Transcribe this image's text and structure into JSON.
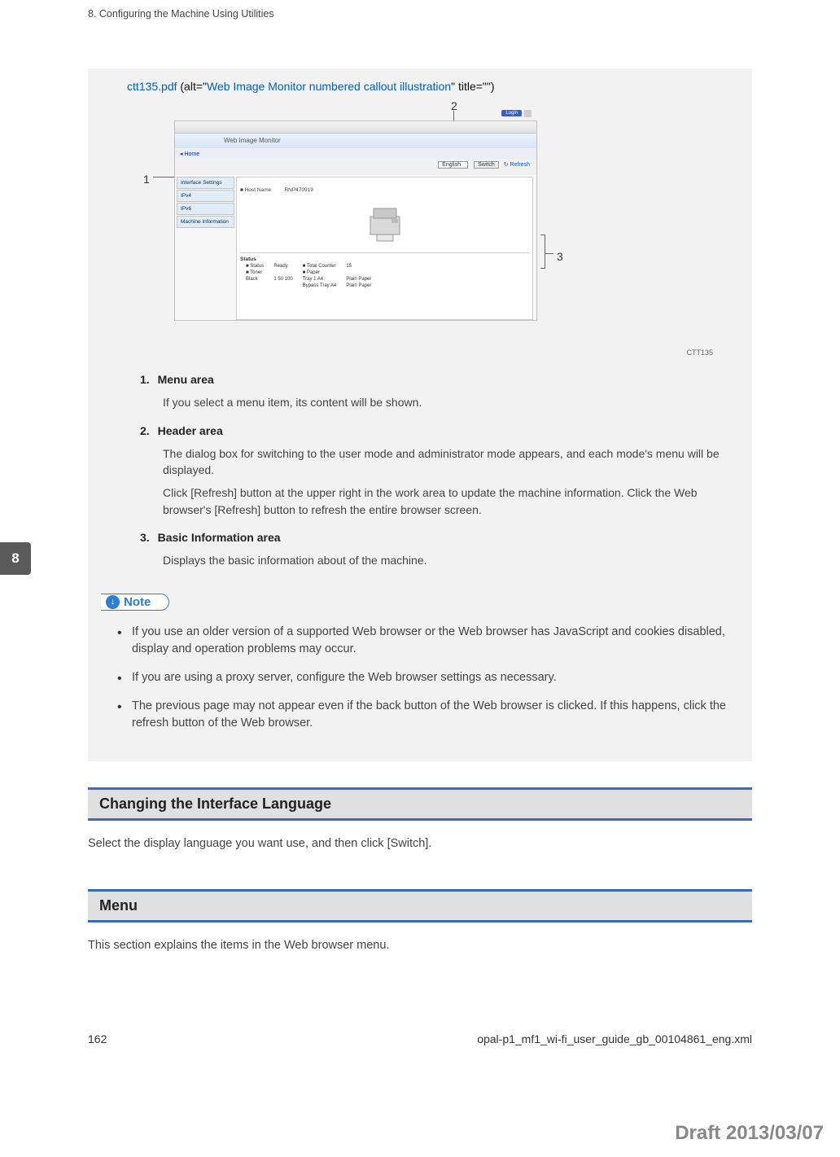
{
  "header": {
    "chapter": "8. Configuring the Machine Using Utilities"
  },
  "sideTab": "8",
  "figure": {
    "linkPrefix": "ctt135.pdf",
    "linkAlt1": " (alt=\"",
    "linkAlt2": "Web Image Monitor numbered callout illustration",
    "linkAlt3": "\" title=\"\")",
    "caption": "CTT135",
    "callouts": {
      "c1": "1",
      "c2": "2",
      "c3": "3"
    },
    "wim": {
      "banner": "Web Image Monitor",
      "login": "Login",
      "home": "◂ Home",
      "langDropdown": "English",
      "switchBtn": "Switch",
      "refreshBtn": "↻ Refresh",
      "sidebar": [
        "Interface Settings",
        "IPv4",
        "IPv6",
        "Machine Information"
      ],
      "hostnameLabel": "■ Host Name",
      "hostnameVal": "RNP470919",
      "status": {
        "title": "Status",
        "rows": [
          [
            "■ Status",
            "Ready",
            "■ Total Counter",
            "15"
          ],
          [
            "■ Toner",
            "",
            "■ Paper",
            ""
          ],
          [
            "Black",
            "1    50    100",
            "Tray 1    A4",
            "Plain Paper"
          ],
          [
            "",
            "",
            "Bypass Tray    A4",
            "Plain Paper"
          ]
        ]
      }
    }
  },
  "numList": [
    {
      "num": "1.",
      "head": "Menu area",
      "descs": [
        "If you select a menu item, its content will be shown."
      ]
    },
    {
      "num": "2.",
      "head": "Header area",
      "descs": [
        "The dialog box for switching to the user mode and administrator mode appears, and each mode's menu will be displayed.",
        "Click [Refresh] button at the upper right in the work area to update the machine information. Click the Web browser's [Refresh] button to refresh the entire browser screen."
      ]
    },
    {
      "num": "3.",
      "head": "Basic Information area",
      "descs": [
        "Displays the basic information about of the machine."
      ]
    }
  ],
  "note": {
    "label": "Note",
    "bullets": [
      "If you use an older version of a supported Web browser or the Web browser has JavaScript and cookies disabled, display and operation problems may occur.",
      "If you are using a proxy server, configure the Web browser settings as necessary.",
      "The previous page may not appear even if the back button of the Web browser is clicked. If this happens, click the refresh button of the Web browser."
    ]
  },
  "sections": [
    {
      "head": "Changing the Interface Language",
      "text": "Select the display language you want use, and then click [Switch]."
    },
    {
      "head": "Menu",
      "text": "This section explains the items in the Web browser menu."
    }
  ],
  "footer": {
    "pageNum": "162",
    "filePath": "opal-p1_mf1_wi-fi_user_guide_gb_00104861_eng.xml"
  },
  "draft": "Draft 2013/03/07"
}
